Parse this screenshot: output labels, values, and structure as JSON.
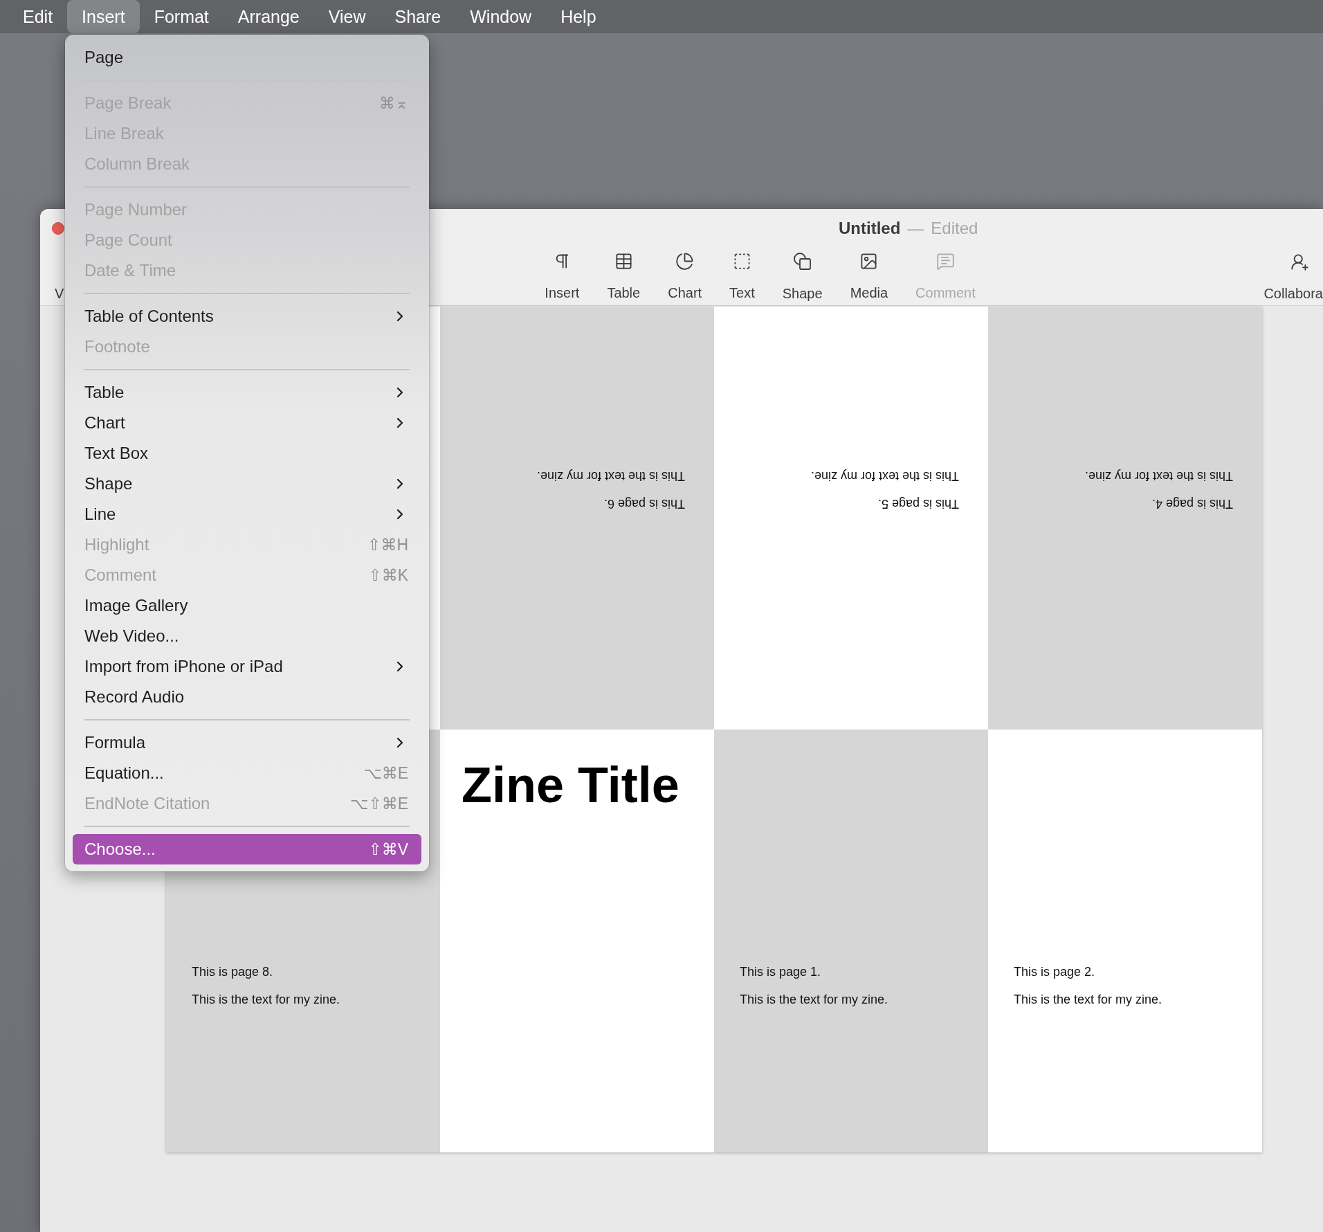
{
  "menu_bar": {
    "items": [
      {
        "label": "Edit",
        "selected": false
      },
      {
        "label": "Insert",
        "selected": true
      },
      {
        "label": "Format",
        "selected": false
      },
      {
        "label": "Arrange",
        "selected": false
      },
      {
        "label": "View",
        "selected": false
      },
      {
        "label": "Share",
        "selected": false
      },
      {
        "label": "Window",
        "selected": false
      },
      {
        "label": "Help",
        "selected": false
      }
    ]
  },
  "window": {
    "title": "Untitled",
    "separator": "—",
    "status": "Edited",
    "toolbar": {
      "view_label": "V",
      "items": [
        {
          "kind": "insert",
          "label": "Insert",
          "disabled": false
        },
        {
          "kind": "table",
          "label": "Table",
          "disabled": false
        },
        {
          "kind": "chart",
          "label": "Chart",
          "disabled": false
        },
        {
          "kind": "text",
          "label": "Text",
          "disabled": false
        },
        {
          "kind": "shape",
          "label": "Shape",
          "disabled": false
        },
        {
          "kind": "media",
          "label": "Media",
          "disabled": false
        },
        {
          "kind": "comment",
          "label": "Comment",
          "disabled": true
        }
      ],
      "collaborate_label": "Collabora"
    },
    "pages": [
      {
        "color": "#ffffff"
      },
      {
        "color": "#d6d6d6",
        "flipped": true,
        "lines": [
          "This is page 6.",
          "This is the text for my zine."
        ]
      },
      {
        "color": "#ffffff",
        "flipped": true,
        "lines": [
          "This is page 5.",
          "This is the text for my zine."
        ]
      },
      {
        "color": "#d6d6d6",
        "flipped": true,
        "lines": [
          "This is page 4.",
          "This is the text for my zine."
        ]
      },
      {
        "color": "#d6d6d6",
        "flipped": false,
        "lines": [
          "This is page 8.",
          "This is the text for my zine."
        ]
      },
      {
        "color": "#ffffff",
        "flipped": false,
        "title": "Zine Title"
      },
      {
        "color": "#d6d6d6",
        "flipped": false,
        "lines": [
          "This is page 1.",
          "This is the text for my zine."
        ]
      },
      {
        "color": "#ffffff",
        "flipped": false,
        "lines": [
          "This is page 2.",
          "This is the text for my zine."
        ]
      }
    ]
  },
  "insert_menu": {
    "items": [
      {
        "kind": "item",
        "label": "Page",
        "disabled": false,
        "submenu": false,
        "selected": false
      },
      {
        "kind": "separator"
      },
      {
        "kind": "item",
        "label": "Page Break",
        "shortcut": "⌘⌅",
        "disabled": true,
        "submenu": false,
        "selected": false
      },
      {
        "kind": "item",
        "label": "Line Break",
        "disabled": true,
        "submenu": false,
        "selected": false
      },
      {
        "kind": "item",
        "label": "Column Break",
        "disabled": true,
        "submenu": false,
        "selected": false
      },
      {
        "kind": "separator"
      },
      {
        "kind": "item",
        "label": "Page Number",
        "disabled": true,
        "submenu": false,
        "selected": false
      },
      {
        "kind": "item",
        "label": "Page Count",
        "disabled": true,
        "submenu": false,
        "selected": false
      },
      {
        "kind": "item",
        "label": "Date & Time",
        "disabled": true,
        "submenu": false,
        "selected": false
      },
      {
        "kind": "separator"
      },
      {
        "kind": "item",
        "label": "Table of Contents",
        "disabled": false,
        "submenu": true,
        "selected": false
      },
      {
        "kind": "item",
        "label": "Footnote",
        "disabled": true,
        "submenu": false,
        "selected": false
      },
      {
        "kind": "separator"
      },
      {
        "kind": "item",
        "label": "Table",
        "disabled": false,
        "submenu": true,
        "selected": false
      },
      {
        "kind": "item",
        "label": "Chart",
        "disabled": false,
        "submenu": true,
        "selected": false
      },
      {
        "kind": "item",
        "label": "Text Box",
        "disabled": false,
        "submenu": false,
        "selected": false
      },
      {
        "kind": "item",
        "label": "Shape",
        "disabled": false,
        "submenu": true,
        "selected": false
      },
      {
        "kind": "item",
        "label": "Line",
        "disabled": false,
        "submenu": true,
        "selected": false
      },
      {
        "kind": "item",
        "label": "Highlight",
        "shortcut": "⇧⌘H",
        "disabled": true,
        "submenu": false,
        "selected": false
      },
      {
        "kind": "item",
        "label": "Comment",
        "shortcut": "⇧⌘K",
        "disabled": true,
        "submenu": false,
        "selected": false
      },
      {
        "kind": "item",
        "label": "Image Gallery",
        "disabled": false,
        "submenu": false,
        "selected": false
      },
      {
        "kind": "item",
        "label": "Web Video...",
        "disabled": false,
        "submenu": false,
        "selected": false
      },
      {
        "kind": "item",
        "label": "Import from iPhone or iPad",
        "disabled": false,
        "submenu": true,
        "selected": false
      },
      {
        "kind": "item",
        "label": "Record Audio",
        "disabled": false,
        "submenu": false,
        "selected": false
      },
      {
        "kind": "separator"
      },
      {
        "kind": "item",
        "label": "Formula",
        "disabled": false,
        "submenu": true,
        "selected": false
      },
      {
        "kind": "item",
        "label": "Equation...",
        "shortcut": "⌥⌘E",
        "disabled": false,
        "submenu": false,
        "selected": false
      },
      {
        "kind": "item",
        "label": "EndNote Citation",
        "shortcut": "⌥⇧⌘E",
        "disabled": true,
        "submenu": false,
        "selected": false
      },
      {
        "kind": "separator"
      },
      {
        "kind": "item",
        "label": "Choose...",
        "shortcut": "⇧⌘V",
        "disabled": false,
        "submenu": false,
        "selected": true
      }
    ]
  }
}
